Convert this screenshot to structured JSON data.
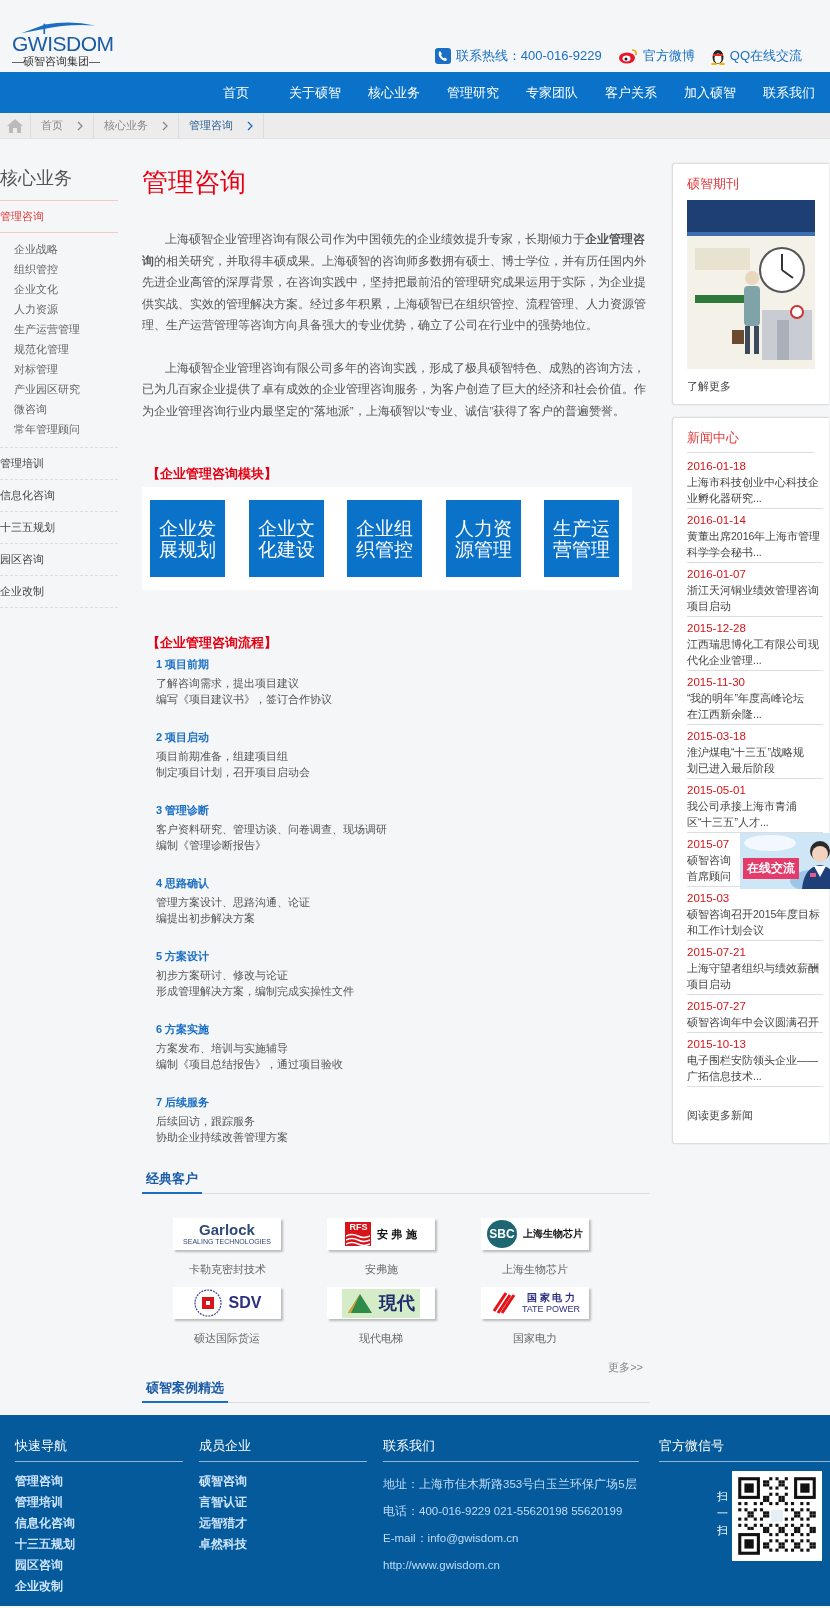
{
  "header": {
    "logo": {
      "wordmark": "GWISDOM",
      "tagline": "—硕智咨询集团—"
    },
    "contacts": [
      {
        "kind": "phone",
        "text": "联系热线：400-016-9229"
      },
      {
        "kind": "weibo",
        "text": "官方微博"
      },
      {
        "kind": "qq",
        "text": "QQ在线交流"
      }
    ]
  },
  "nav": [
    "首页",
    "关于硕智",
    "核心业务",
    "管理研究",
    "专家团队",
    "客户关系",
    "加入硕智",
    "联系我们"
  ],
  "breadcrumb": [
    {
      "label": "首页",
      "current": false
    },
    {
      "label": "核心业务",
      "current": false
    },
    {
      "label": "管理咨询",
      "current": true
    }
  ],
  "sidebar": {
    "title": "核心业务",
    "items": [
      {
        "label": "管理咨询",
        "selected": true,
        "children": [
          {
            "label": "企业战略",
            "selected": false
          },
          {
            "label": "组织管控",
            "selected": false
          },
          {
            "label": "企业文化",
            "selected": false
          },
          {
            "label": "人力资源",
            "selected": false
          },
          {
            "label": "生产运营管理",
            "selected": false
          },
          {
            "label": "规范化管理",
            "selected": false
          },
          {
            "label": "对标管理",
            "selected": false
          },
          {
            "label": "产业园区研究",
            "selected": false
          },
          {
            "label": "微咨询",
            "selected": false
          },
          {
            "label": "常年管理顾问",
            "selected": false
          }
        ]
      },
      {
        "label": "管理培训",
        "selected": false
      },
      {
        "label": "信息化咨询",
        "selected": false
      },
      {
        "label": "十三五规划",
        "selected": false
      },
      {
        "label": "园区咨询",
        "selected": false
      },
      {
        "label": "企业改制",
        "selected": false
      }
    ]
  },
  "content": {
    "title": "管理咨询",
    "paragraphs": [
      "上海硕智企业管理咨询有限公司作为中国领先的企业绩效提升专家，长期倾力于**企业管理咨询**的相关研究，并取得丰硕成果。上海硕智的咨询师多数拥有硕士、博士学位，并有历任国内外先进企业高管的深厚背景，在咨询实践中，坚持把最前沿的管理研究成果运用于实际，为企业提供实战、实效的管理解决方案。经过多年积累，上海硕智已在组织管控、流程管理、人力资源管理、生产运营管理等咨询方向具备强大的专业优势，确立了公司在行业中的强势地位。",
      "上海硕智企业管理咨询有限公司多年的咨询实践，形成了极具硕智特色、成熟的咨询方法，已为几百家企业提供了卓有成效的企业管理咨询服务，为客户创造了巨大的经济和社会价值。作为企业管理咨询行业内最坚定的“落地派”，上海硕智以“专业、诚信”获得了客户的普遍赞誉。"
    ],
    "modules": {
      "heading": "【企业管理咨询模块】",
      "tiles": [
        "企业发展规划",
        "企业文化建设",
        "企业组织管控",
        "人力资源管理",
        "生产运营管理"
      ]
    },
    "process": {
      "heading": "【企业管理咨询流程】",
      "steps": [
        {
          "title": "1  项目前期",
          "lines": [
            "了解咨询需求，提出项目建议",
            "编写《项目建议书》，签订合作协议"
          ]
        },
        {
          "title": "2  项目启动",
          "lines": [
            "项目前期准备，组建项目组",
            "制定项目计划，召开项目启动会"
          ]
        },
        {
          "title": "3  管理诊断",
          "lines": [
            "客户资料研究、管理访谈、问卷调查、现场调研",
            "编制《管理诊断报告》"
          ]
        },
        {
          "title": "4  思路确认",
          "lines": [
            "管理方案设计、思路沟通、论证",
            "编提出初步解决方案"
          ]
        },
        {
          "title": "5  方案设计",
          "lines": [
            "初步方案研讨、修改与论证",
            "形成管理解决方案，编制完成实操性文件"
          ]
        },
        {
          "title": "6  方案实施",
          "lines": [
            "方案发布、培训与实施辅导",
            "编制《项目总结报告》，通过项目验收"
          ]
        },
        {
          "title": "7  后续服务",
          "lines": [
            "后续回访，跟踪服务",
            "协助企业持续改善管理方案"
          ]
        }
      ]
    },
    "clients": {
      "heading": "经典客户",
      "items": [
        {
          "name": "卡勒克密封技术",
          "logo": {
            "kind": "wordmark",
            "texts": [
              "Garlock",
              "SEALING TECHNOLOGIES"
            ]
          }
        },
        {
          "name": "安弗施",
          "logo": {
            "kind": "stripes",
            "texts": [
              "RFS",
              "安 弗 施"
            ]
          }
        },
        {
          "name": "上海生物芯片",
          "logo": {
            "kind": "disc",
            "texts": [
              "SBC",
              "上海生物芯片"
            ]
          }
        },
        {
          "name": "硕达国际货运",
          "logo": {
            "kind": "ring",
            "texts": [
              "SDV"
            ]
          }
        },
        {
          "name": "现代电梯",
          "logo": {
            "kind": "triangle",
            "texts": [
              "現代"
            ]
          }
        },
        {
          "name": "国家电力",
          "logo": {
            "kind": "slash",
            "texts": [
              "国 家 电 力",
              "TATE POWER"
            ]
          }
        }
      ],
      "more": "更多>>"
    },
    "cases": {
      "heading": "硕智案例精选"
    }
  },
  "journal": {
    "title": "硕智期刊",
    "more": "了解更多"
  },
  "news": {
    "title": "新闻中心",
    "items": [
      {
        "date": "2016-01-18",
        "lines": [
          "上海市科技创业中心科技企",
          "业孵化器研究..."
        ]
      },
      {
        "date": "2016-01-14",
        "lines": [
          "黄董出席2016年上海市管理",
          "科学学会秘书..."
        ]
      },
      {
        "date": "2016-01-07",
        "lines": [
          "浙江天河铜业绩效管理咨询",
          "项目启动"
        ]
      },
      {
        "date": "2015-12-28",
        "lines": [
          "江西瑞思博化工有限公司现",
          "代化企业管理..."
        ]
      },
      {
        "date": "2015-11-30",
        "lines": [
          "“我的明年”年度高峰论坛",
          "在江西新余隆..."
        ]
      },
      {
        "date": "2015-03-18",
        "lines": [
          "淮沪煤电“十三五”战略规",
          "划已进入最后阶段"
        ]
      },
      {
        "date": "2015-05-01",
        "lines": [
          "我公司承接上海市青浦",
          "区“十三五”人才..."
        ]
      },
      {
        "date": "2015-07",
        "lines": [
          "硕智咨询",
          "首席顾问"
        ]
      },
      {
        "date": "2015-03",
        "lines": [
          "硕智咨询召开2015年度目标",
          "和工作计划会议"
        ]
      },
      {
        "date": "2015-07-21",
        "lines": [
          "上海守望者组织与绩效薪酬",
          "项目启动"
        ]
      },
      {
        "date": "2015-07-27",
        "lines": [
          "硕智咨询年中会议圆满召开"
        ]
      },
      {
        "date": "2015-10-13",
        "lines": [
          "电子围栏安防领头企业——",
          "广拓信息技术..."
        ]
      }
    ],
    "more": "阅读更多新闻"
  },
  "chat": {
    "label": "在线交流"
  },
  "footer": {
    "columns": [
      {
        "kind": "links",
        "title": "快速导航",
        "entries": [
          "管理咨询",
          "管理培训",
          "信息化咨询",
          "十三五规划",
          "园区咨询",
          "企业改制"
        ]
      },
      {
        "kind": "links",
        "title": "成员企业",
        "entries": [
          "硕智咨询",
          "言智认证",
          "远智猎才",
          "卓然科技"
        ]
      },
      {
        "kind": "contact",
        "title": "联系我们",
        "entries": [
          "地址：上海市佳木斯路353号白玉兰环保广场5层",
          "电话：400-016-9229 021-55620198 55620199",
          "E-mail：info@gwisdom.cn",
          "http://www.gwisdom.cn"
        ]
      },
      {
        "kind": "wechat",
        "title": "官方微信号",
        "entries": [
          "扫",
          "一",
          "扫"
        ]
      }
    ]
  }
}
